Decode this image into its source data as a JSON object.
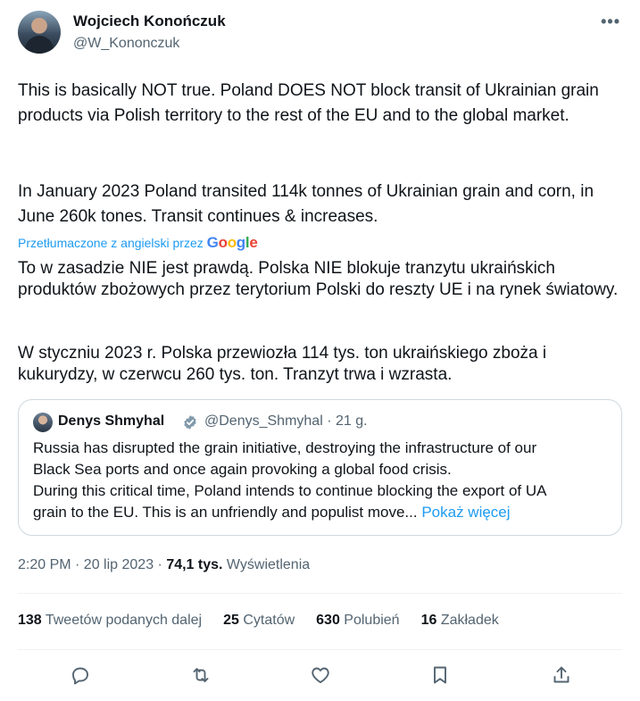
{
  "author": {
    "name": "Wojciech Konończuk",
    "handle": "@W_Kononczuk"
  },
  "more_label": "•••",
  "tweet": {
    "paragraph1": "This is basically NOT true. Poland DOES NOT block transit of Ukrainian grain products via Polish territory to the rest of the EU and to the global market.",
    "paragraph2": "In January 2023 Poland transited 114k tonnes of Ukrainian grain and corn, in June 260k tones. Transit continues & increases."
  },
  "translation": {
    "label": "Przetłumaczone z angielski przez",
    "provider": "Google",
    "paragraph1": "To w zasadzie NIE jest prawdą. Polska NIE blokuje tranzytu ukraińskich produktów zbożowych przez terytorium Polski do reszty UE i na rynek światowy.",
    "paragraph2": "W styczniu 2023 r. Polska przewiozła 114 tys. ton ukraińskiego zboża i kukurydzy, w czerwcu 260 tys. ton. Tranzyt trwa i wzrasta."
  },
  "quote": {
    "name": "Denys Shmyhal",
    "handle_time": "@Denys_Shmyhal · 21 g.",
    "text": "Russia has disrupted the grain initiative, destroying the infrastructure of our Black Sea ports and once again provoking a global food crisis. During this critical time, Poland intends to continue blocking the export of UA grain to the EU. This is an unfriendly and populist move...",
    "line1": "Russia has disrupted the grain initiative, destroying the infrastructure of our",
    "line2": "Black Sea ports and once again provoking a global food crisis.",
    "line3": "During this critical time, Poland intends to continue blocking the export of UA",
    "line4": "grain to the EU. This is an unfriendly and populist move...",
    "show_more": "Pokaż więcej"
  },
  "meta": {
    "time_date": "2:20 PM · 20 lip 2023 · ",
    "views_count": "74,1 tys.",
    "views_label": "Wyświetlenia"
  },
  "stats": [
    {
      "count": "138",
      "label": "Tweetów podanych dalej"
    },
    {
      "count": "25",
      "label": "Cytatów"
    },
    {
      "count": "630",
      "label": "Polubień"
    },
    {
      "count": "16",
      "label": "Zakładek"
    }
  ],
  "icons": {
    "reply": "reply-icon",
    "retweet": "retweet-icon",
    "like": "heart-icon",
    "bookmark": "bookmark-icon",
    "share": "share-icon"
  },
  "colors": {
    "accent": "#1d9bf0",
    "secondary_text": "#536471",
    "text": "#0f1419"
  }
}
